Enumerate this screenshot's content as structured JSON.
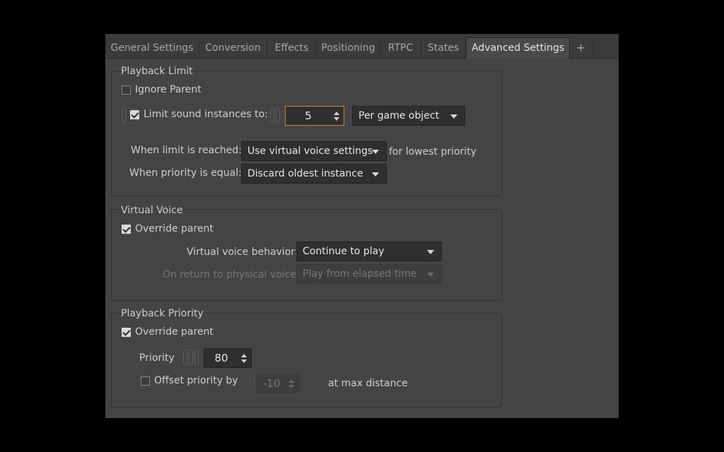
{
  "tabs": [
    {
      "label": "General Settings"
    },
    {
      "label": "Conversion"
    },
    {
      "label": "Effects"
    },
    {
      "label": "Positioning"
    },
    {
      "label": "RTPC"
    },
    {
      "label": "States"
    },
    {
      "label": "Advanced Settings"
    },
    {
      "label": "+"
    }
  ],
  "active_tab": "Advanced Settings",
  "playback_limit": {
    "title": "Playback Limit",
    "ignore_parent": {
      "label": "Ignore Parent",
      "checked": false
    },
    "limit_instances": {
      "label": "Limit sound instances to:",
      "checked": true,
      "value": "5"
    },
    "scope": "Per game object",
    "when_limit_label": "When limit is reached:",
    "when_limit_value": "Use virtual voice settings",
    "when_limit_suffix": "for lowest priority",
    "when_equal_label": "When priority is equal:",
    "when_equal_value": "Discard oldest instance"
  },
  "virtual_voice": {
    "title": "Virtual Voice",
    "override": {
      "label": "Override parent",
      "checked": true
    },
    "behavior_label": "Virtual voice behavior:",
    "behavior_value": "Continue to play",
    "return_label": "On return to physical voice:",
    "return_value": "Play from elapsed time"
  },
  "playback_priority": {
    "title": "Playback Priority",
    "override": {
      "label": "Override parent",
      "checked": true
    },
    "priority_label": "Priority",
    "priority_value": "80",
    "offset": {
      "label": "Offset priority by",
      "checked": false,
      "value": "-10"
    },
    "offset_suffix": "at max distance"
  },
  "colors": {
    "accent_focus": "#c98a3b",
    "panel_bg": "#444444",
    "field_bg": "#2f2f2f"
  }
}
